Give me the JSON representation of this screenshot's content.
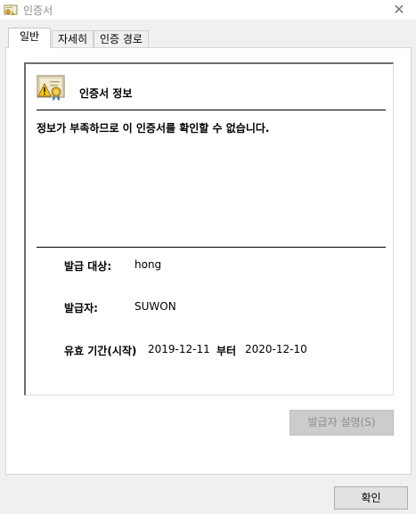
{
  "window": {
    "title": "인증서",
    "icon": "certificate-icon",
    "close_glyph": "✕"
  },
  "tabs": [
    {
      "label": "일반",
      "active": true
    },
    {
      "label": "자세히",
      "active": false
    },
    {
      "label": "인증 경로",
      "active": false
    }
  ],
  "certificate": {
    "heading": "인증서 정보",
    "warning": "정보가 부족하므로 이 인증서를 확인할 수 없습니다.",
    "issued_to_label": "발급 대상:",
    "issued_to_value": "hong",
    "issued_by_label": "발급자:",
    "issued_by_value": "SUWON",
    "validity_label": "유효 기간(시작)",
    "valid_from": "2019-12-11",
    "to_label": "부터",
    "valid_to": "2020-12-10"
  },
  "buttons": {
    "issuer_statement": "발급자 설명(S)",
    "issuer_statement_enabled": false,
    "ok": "확인"
  },
  "colors": {
    "window_bg": "#f0f0f0",
    "panel_bg": "#ffffff",
    "disabled_button_bg": "#cccccc",
    "disabled_text": "#8d8d8d"
  }
}
